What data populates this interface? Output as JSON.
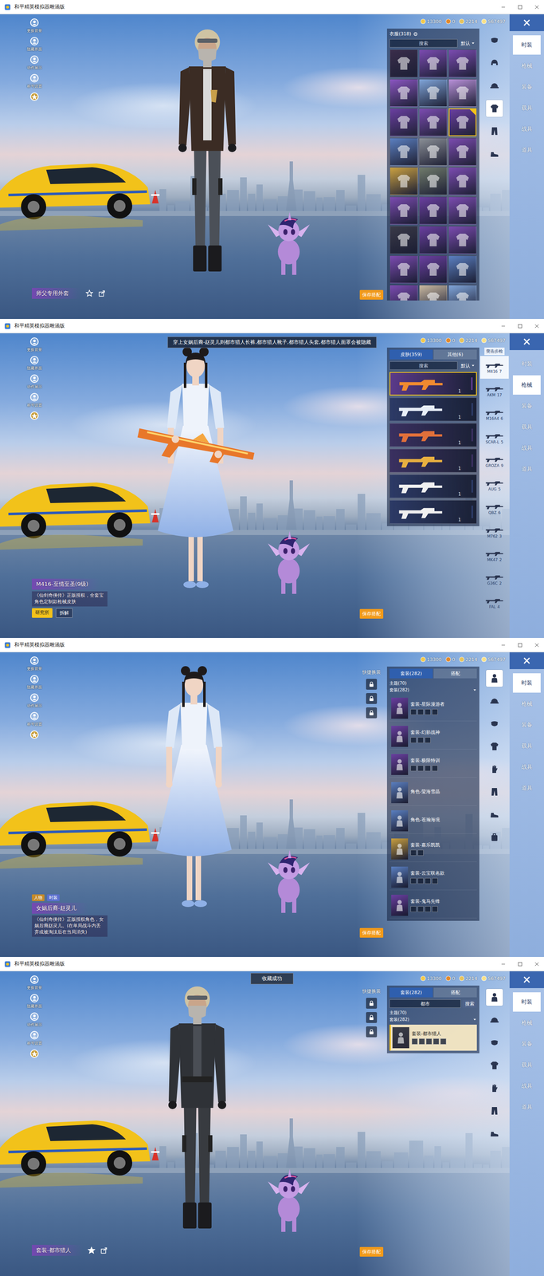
{
  "app": {
    "title": "和平精英模拟器雕涵版",
    "currency": [
      {
        "value": "13300",
        "color": "#f2c94c"
      },
      {
        "value": "0",
        "color": "#e08a30"
      },
      {
        "value": "2214",
        "color": "#e6c35c"
      },
      {
        "value": "567497",
        "color": "#f7e08a"
      }
    ],
    "left_menu": [
      {
        "label": "更换背景"
      },
      {
        "label": "隐藏界面"
      },
      {
        "label": "动作展示"
      },
      {
        "label": "称号设置"
      }
    ]
  },
  "panels": [
    {
      "figure": {
        "kind": "jacket"
      },
      "side_tabs": [
        {
          "label": "时装",
          "selected": true
        },
        {
          "label": "枪械",
          "selected": false
        },
        {
          "label": "装备",
          "selected": false
        },
        {
          "label": "载具",
          "selected": false
        },
        {
          "label": "战具",
          "selected": false
        },
        {
          "label": "道具",
          "selected": false
        }
      ],
      "category_icons": [
        {
          "selected": false
        },
        {
          "selected": false
        },
        {
          "selected": false
        },
        {
          "selected": true
        },
        {
          "selected": false
        },
        {
          "selected": false
        }
      ],
      "label": {
        "title": "师父专用外套",
        "favorited": false
      },
      "save": "保存搭配",
      "list": {
        "kind": "grid",
        "header": "衣服(318)",
        "search": {
          "placeholder": "搜索"
        },
        "sort": "默认",
        "items": [
          {
            "color": "#3a2d4a",
            "selected": false
          },
          {
            "color": "#7b4bb0",
            "selected": false
          },
          {
            "color": "#7b4bb0",
            "selected": false
          },
          {
            "color": "#8a55c0",
            "selected": false
          },
          {
            "color": "#7fa4d8",
            "selected": false
          },
          {
            "color": "#b890d8",
            "selected": false
          },
          {
            "color": "#6a3fa0",
            "selected": false
          },
          {
            "color": "#7b4bb0",
            "selected": false
          },
          {
            "color": "#6a3fa0",
            "selected": true
          },
          {
            "color": "#5a7fc0",
            "selected": false
          },
          {
            "color": "#8a8f96",
            "selected": false
          },
          {
            "color": "#7b4bb0",
            "selected": false
          },
          {
            "color": "#c9a040",
            "selected": false
          },
          {
            "color": "#6f7a6a",
            "selected": false
          },
          {
            "color": "#7b4bb0",
            "selected": false
          },
          {
            "color": "#7b4bb0",
            "selected": false
          },
          {
            "color": "#6a3fa0",
            "selected": false
          },
          {
            "color": "#7b4bb0",
            "selected": false
          },
          {
            "color": "#3a3a48",
            "selected": false
          },
          {
            "color": "#6a3fa0",
            "selected": false
          },
          {
            "color": "#7b4bb0",
            "selected": false
          },
          {
            "color": "#7b4bb0",
            "selected": false
          },
          {
            "color": "#6a3fa0",
            "selected": false
          },
          {
            "color": "#5a7fc0",
            "selected": false
          },
          {
            "color": "#7b4bb0",
            "selected": false
          },
          {
            "color": "#c8b8a0",
            "selected": false
          },
          {
            "color": "#7fa4d8",
            "selected": false
          }
        ]
      }
    },
    {
      "figure": {
        "kind": "dress-gun"
      },
      "notice": "穿上女娲后裔-赵灵儿则都市猎人长裤,都市猎人靴子,都市猎人头套,都市猎人面罩会被隐藏",
      "side_tabs": [
        {
          "label": "时装",
          "selected": false
        },
        {
          "label": "枪械",
          "selected": true
        },
        {
          "label": "装备",
          "selected": false
        },
        {
          "label": "载具",
          "selected": false
        },
        {
          "label": "战具",
          "selected": false
        },
        {
          "label": "道具",
          "selected": false
        }
      ],
      "weapon_col": {
        "header": "突击步枪",
        "items": [
          {
            "name": "M416",
            "count": "7",
            "selected": true
          },
          {
            "name": "AKM",
            "count": "17",
            "selected": false
          },
          {
            "name": "M16A4",
            "count": "6",
            "selected": false
          },
          {
            "name": "SCAR-L",
            "count": "5",
            "selected": false
          },
          {
            "name": "GROZA",
            "count": "9",
            "selected": false
          },
          {
            "name": "AUG",
            "count": "5",
            "selected": false
          },
          {
            "name": "QBZ",
            "count": "6",
            "selected": false
          },
          {
            "name": "M762",
            "count": "3",
            "selected": false
          },
          {
            "name": "MK47",
            "count": "2",
            "selected": false
          },
          {
            "name": "G36C",
            "count": "2",
            "selected": false
          },
          {
            "name": "FAL",
            "count": "4",
            "selected": false
          }
        ]
      },
      "label": {
        "title": "M416-至情至圣(9级)",
        "desc": "《仙剑奇侠传》正版授权，全套宝角色定制款枪械皮肤",
        "buttons": [
          {
            "label": "研究所",
            "kind": "primary"
          },
          {
            "label": "拆解",
            "kind": "plain"
          }
        ]
      },
      "save": "保存搭配",
      "list": {
        "kind": "skins",
        "tabs": [
          {
            "label": "皮肤(359)",
            "selected": true
          },
          {
            "label": "其他(6)",
            "selected": false
          }
        ],
        "search": {
          "placeholder": "搜索"
        },
        "sort": "默认",
        "items": [
          {
            "count": "1",
            "color": "#5b3a8a",
            "accent": "#f08a30",
            "selected": true
          },
          {
            "count": "1",
            "color": "#2c3a66",
            "accent": "#e8eef8",
            "selected": false
          },
          {
            "count": "1",
            "color": "#3a3060",
            "accent": "#e0703a",
            "selected": false
          },
          {
            "count": "1",
            "color": "#3a3060",
            "accent": "#e8b040",
            "selected": false
          },
          {
            "count": "1",
            "color": "#2c3a66",
            "accent": "#f0f0f0",
            "selected": false
          },
          {
            "count": "1",
            "color": "#2c3a66",
            "accent": "#f0f0f0",
            "selected": false
          }
        ]
      }
    },
    {
      "figure": {
        "kind": "dress"
      },
      "side_tabs": [
        {
          "label": "时装",
          "selected": true
        },
        {
          "label": "枪械",
          "selected": false
        },
        {
          "label": "装备",
          "selected": false
        },
        {
          "label": "载具",
          "selected": false
        },
        {
          "label": "战具",
          "selected": false
        },
        {
          "label": "道具",
          "selected": false
        }
      ],
      "category_icons": [
        {
          "selected": true
        },
        {
          "selected": false
        },
        {
          "selected": false
        },
        {
          "selected": false
        },
        {
          "selected": false
        },
        {
          "selected": false
        },
        {
          "selected": false
        },
        {
          "selected": false
        }
      ],
      "quick_change": {
        "label": "快捷换装",
        "slots": [
          {
            "locked": true
          },
          {
            "locked": true
          },
          {
            "locked": true
          }
        ]
      },
      "label": {
        "tags": [
          {
            "label": "人物",
            "color": "#c48a2a"
          },
          {
            "label": "时装",
            "color": "#5a6fd0"
          }
        ],
        "title": "女娲后裔-赵灵儿",
        "desc": "《仙剑奇侠传》正版授权角色，女娲后裔赵灵儿。(在单局战斗内丢弃或被淘汰后在当局消失)"
      },
      "save": "保存搭配",
      "list": {
        "kind": "outfits",
        "tabs": [
          {
            "label": "套装(282)",
            "selected": true
          },
          {
            "label": "搭配",
            "selected": false
          }
        ],
        "filters": [
          "主题(70)",
          "套装(282)"
        ],
        "items": [
          {
            "name": "套装-星际漫游者",
            "pieces": 4,
            "color": "#6a3fa0",
            "selected": false
          },
          {
            "name": "套装-幻影战神",
            "pieces": 3,
            "color": "#6a3fa0",
            "selected": false
          },
          {
            "name": "套装-极限特训",
            "pieces": 4,
            "color": "#6a3fa0",
            "selected": false
          },
          {
            "name": "角色-莹海雪晶",
            "pieces": 0,
            "color": "#5a7fc0",
            "selected": false
          },
          {
            "name": "角色-苍瀚海境",
            "pieces": 0,
            "color": "#5a7fc0",
            "selected": false
          },
          {
            "name": "套装-嘉乐凯凯",
            "pieces": 2,
            "color": "#c9a040",
            "selected": false
          },
          {
            "name": "套装-云宝联名款",
            "pieces": 4,
            "color": "#5a7fc0",
            "selected": false
          },
          {
            "name": "套装-鬼马先锋",
            "pieces": 4,
            "color": "#6a3fa0",
            "selected": false
          }
        ]
      }
    },
    {
      "figure": {
        "kind": "hunter"
      },
      "toast": "收藏成功",
      "side_tabs": [
        {
          "label": "时装",
          "selected": true
        },
        {
          "label": "枪械",
          "selected": false
        },
        {
          "label": "装备",
          "selected": false
        },
        {
          "label": "载具",
          "selected": false
        },
        {
          "label": "战具",
          "selected": false
        },
        {
          "label": "道具",
          "selected": false
        }
      ],
      "category_icons": [
        {
          "selected": true
        },
        {
          "selected": false
        },
        {
          "selected": false
        },
        {
          "selected": false
        },
        {
          "selected": false
        },
        {
          "selected": false
        },
        {
          "selected": false
        }
      ],
      "quick_change": {
        "label": "快捷换装",
        "slots": [
          {
            "locked": true
          },
          {
            "locked": true
          },
          {
            "locked": true
          }
        ]
      },
      "label": {
        "title": "套装-都市猎人",
        "favorited": true
      },
      "save": "保存搭配",
      "list": {
        "kind": "outfits",
        "tabs": [
          {
            "label": "套装(282)",
            "selected": true
          },
          {
            "label": "搭配",
            "selected": false
          }
        ],
        "search": {
          "value": "都市",
          "button": "搜索"
        },
        "filters": [
          "主题(70)",
          "套装(282)"
        ],
        "items": [
          {
            "name": "套装-都市猎人",
            "pieces": 5,
            "color": "#3a3d48",
            "selected": true
          }
        ]
      }
    }
  ]
}
